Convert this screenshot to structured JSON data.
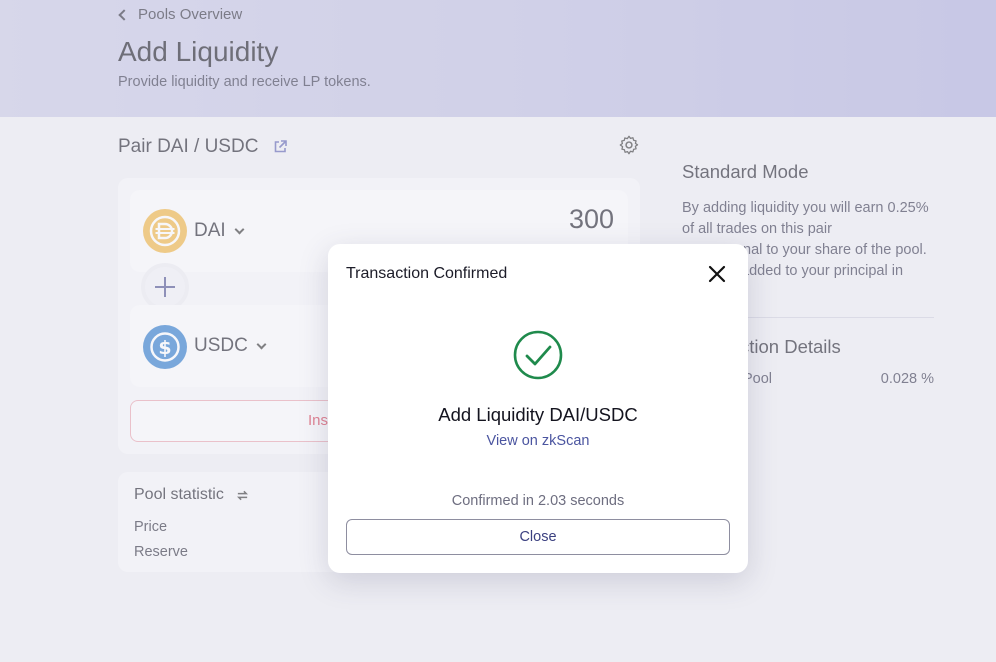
{
  "header": {
    "back_label": "Pools Overview",
    "title": "Add Liquidity",
    "subtitle": "Provide liquidity and receive LP tokens."
  },
  "pair": {
    "title": "Pair DAI / USDC"
  },
  "tokens": [
    {
      "symbol": "DAI",
      "amount": "300",
      "icon": "dai-coin-icon"
    },
    {
      "symbol": "USDC",
      "amount": "",
      "icon": "usdc-coin-icon"
    }
  ],
  "action_button": {
    "visible_label": "Ins"
  },
  "pool_statistic": {
    "title": "Pool statistic",
    "rows": [
      "Price",
      "Reserve"
    ]
  },
  "side": {
    "mode_title": "Standard Mode",
    "mode_text": "By adding liquidity you will earn 0.25% of all trades on this pair",
    "mode_text_2": "nal to your share of the pool.",
    "mode_text_3": "added to your principal in",
    "details_title": "ction Details",
    "share_label": "Pool",
    "share_value": "0.028 %"
  },
  "modal": {
    "title": "Transaction Confirmed",
    "headline": "Add Liquidity DAI/USDC",
    "link": "View on zkScan",
    "confirmed": "Confirmed in 2.03 seconds",
    "close_label": "Close"
  },
  "colors": {
    "accent": "#4b55a0",
    "success": "#1f8a4c",
    "error": "#d7384f",
    "dai": "#f0b13b",
    "usdc": "#2775ca"
  }
}
